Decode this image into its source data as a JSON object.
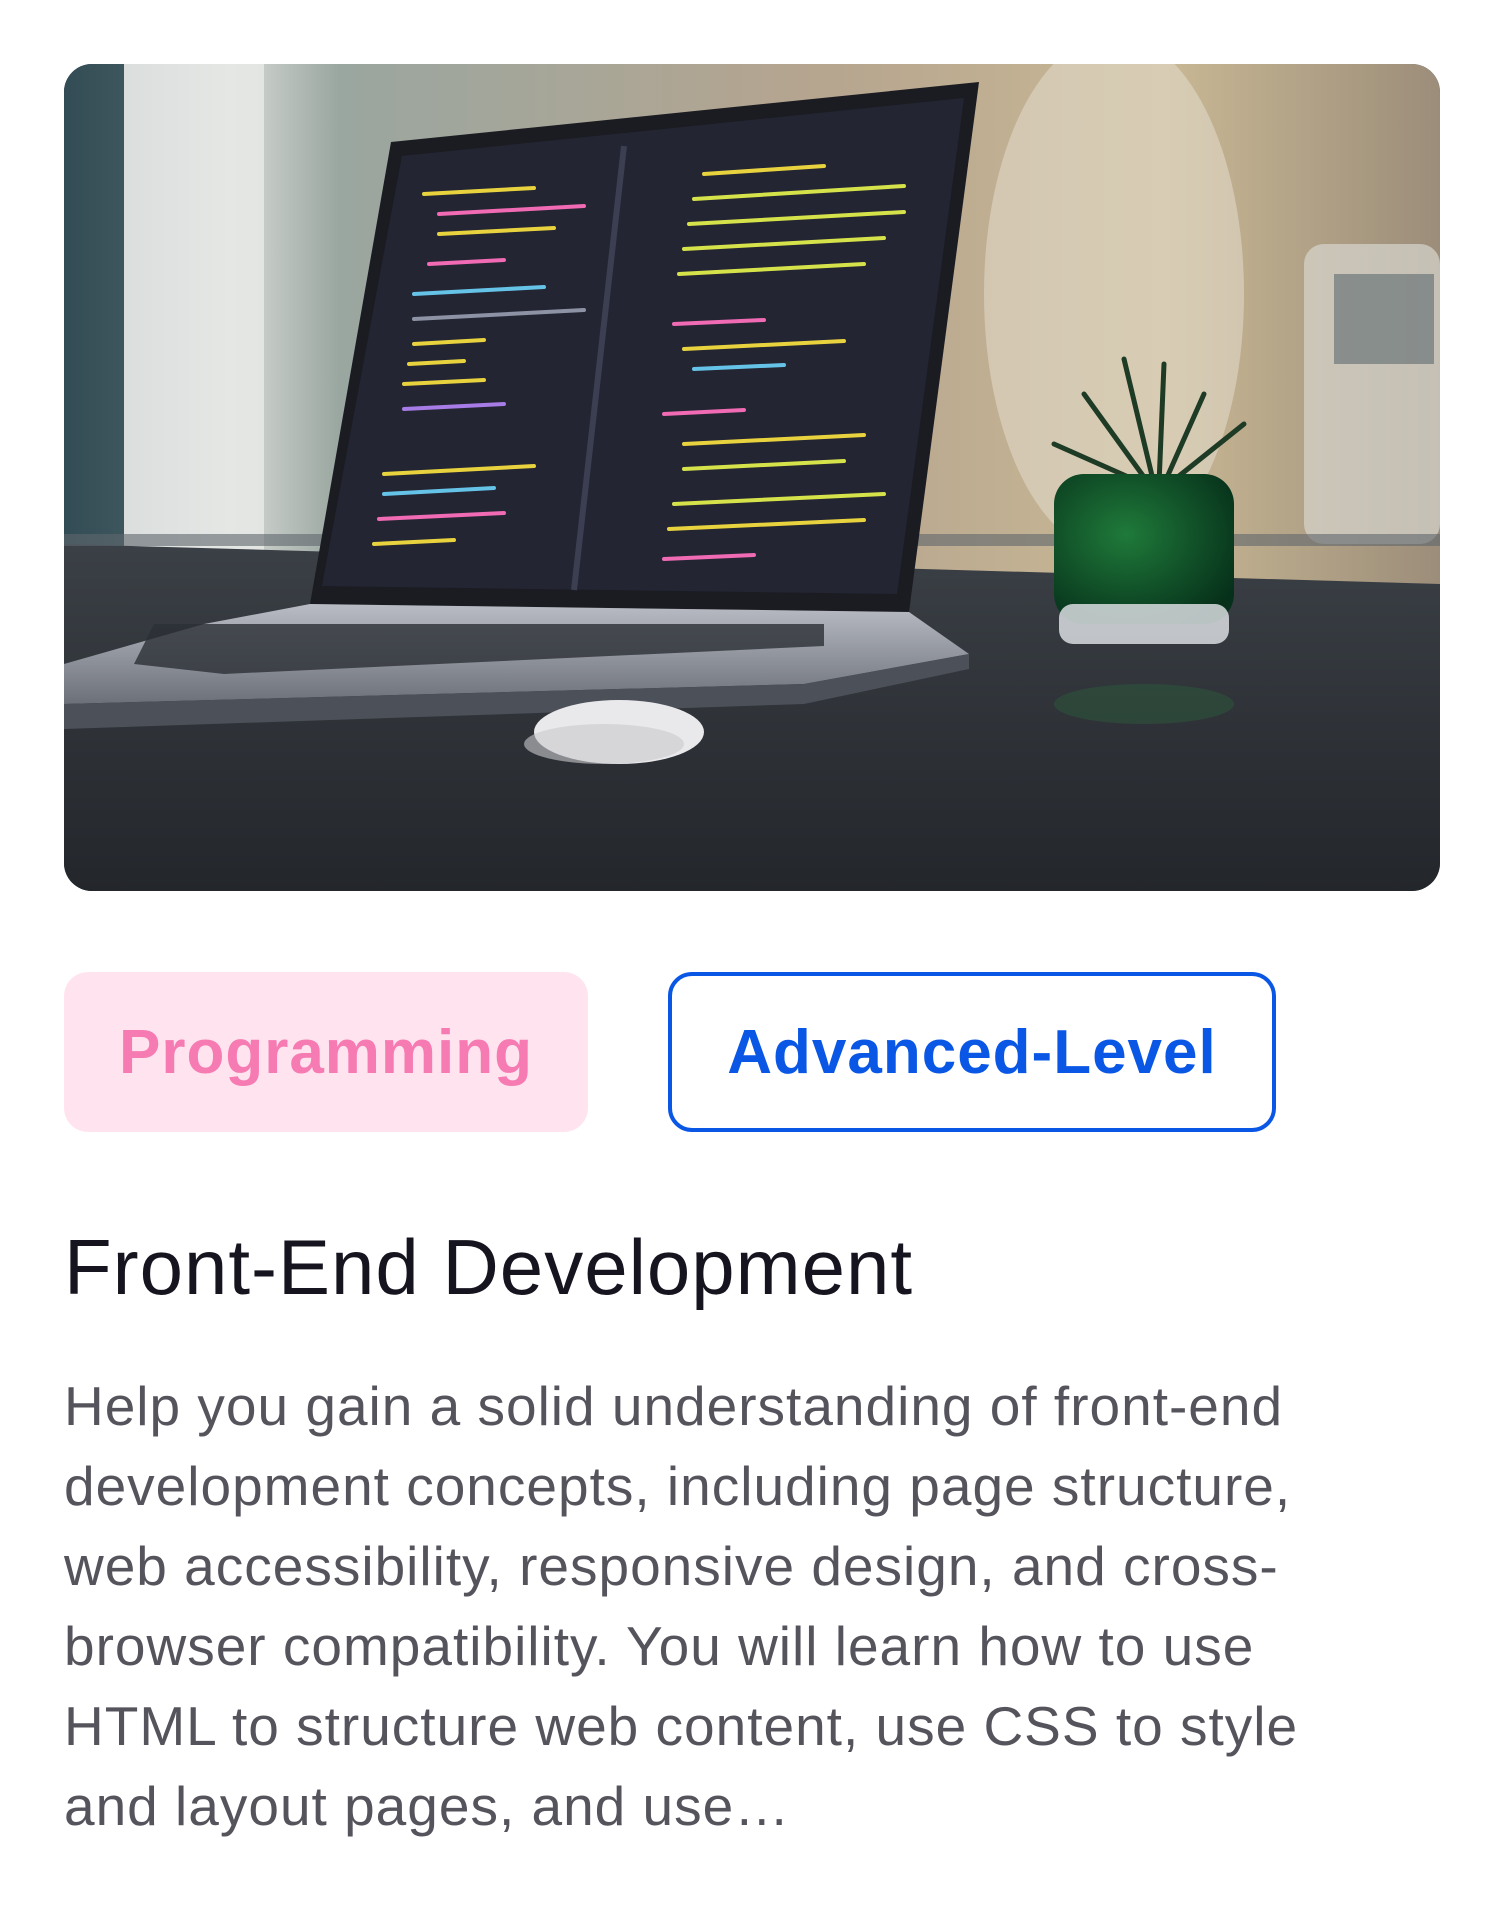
{
  "course": {
    "image_alt": "Laptop showing code editor on a table next to a small potted plant",
    "tags": {
      "category": "Programming",
      "level": "Advanced-Level"
    },
    "title": "Front-End Development",
    "description": "Help you gain a solid understanding of front-end development concepts, including page structure, web accessibility, responsive design, and cross-browser compatibility. You will learn how to use HTML to structure web content, use CSS to style and layout pages, and use…"
  },
  "colors": {
    "category_bg": "#ffe4ef",
    "category_text": "#f67bb2",
    "level_border": "#0a57e5",
    "level_text": "#0a57e5",
    "title_text": "#15141f",
    "description_text": "#55545c"
  },
  "icons": {
    "hero": "laptop-code-photo"
  }
}
